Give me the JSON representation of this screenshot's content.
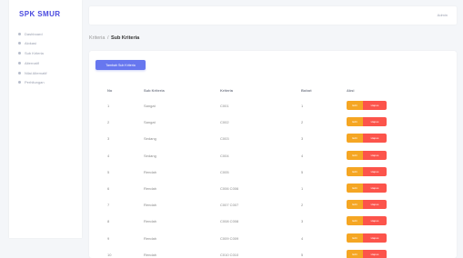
{
  "brand": {
    "title": "SPK SMUR"
  },
  "sidebar": {
    "items": [
      {
        "label": "Dashboard"
      },
      {
        "label": "Alokasi"
      },
      {
        "label": "Sub Kriteria"
      },
      {
        "label": "Alternatif"
      },
      {
        "label": "Nilai Alternatif"
      },
      {
        "label": "Perhitungan"
      }
    ]
  },
  "topbar": {
    "user_label": "Admin"
  },
  "breadcrumb": {
    "parent": "Kriteria",
    "separator": "/",
    "current": "Sub Kriteria"
  },
  "card": {
    "add_button_label": "Tambah Sub Kriteria"
  },
  "table": {
    "headers": {
      "no": "No",
      "name": "Sub Kriteria",
      "code": "Kriteria",
      "qty": "Bobot",
      "action": "Aksi"
    },
    "rows": [
      {
        "no": "1",
        "name": "Sangat",
        "code": "C001",
        "qty": "1"
      },
      {
        "no": "2",
        "name": "Sangat",
        "code": "C002",
        "qty": "2"
      },
      {
        "no": "3",
        "name": "Sedang",
        "code": "C003",
        "qty": "3"
      },
      {
        "no": "4",
        "name": "Sedang",
        "code": "C004",
        "qty": "4"
      },
      {
        "no": "5",
        "name": "Rendah",
        "code": "C005",
        "qty": "5"
      },
      {
        "no": "6",
        "name": "Rendah",
        "code": "C006 C006",
        "qty": "1"
      },
      {
        "no": "7",
        "name": "Rendah",
        "code": "C007 C007",
        "qty": "2"
      },
      {
        "no": "8",
        "name": "Rendah",
        "code": "C008 C008",
        "qty": "3"
      },
      {
        "no": "9",
        "name": "Rendah",
        "code": "C009 C009",
        "qty": "4"
      },
      {
        "no": "10",
        "name": "Rendah",
        "code": "C010 C010",
        "qty": "5"
      }
    ],
    "edit_label": "Edit",
    "delete_label": "Hapus"
  },
  "colors": {
    "accent": "#6777ef",
    "brand": "#4a4adf",
    "edit": "#f5a623",
    "delete": "#fc544b",
    "background": "#f4f6f9"
  }
}
